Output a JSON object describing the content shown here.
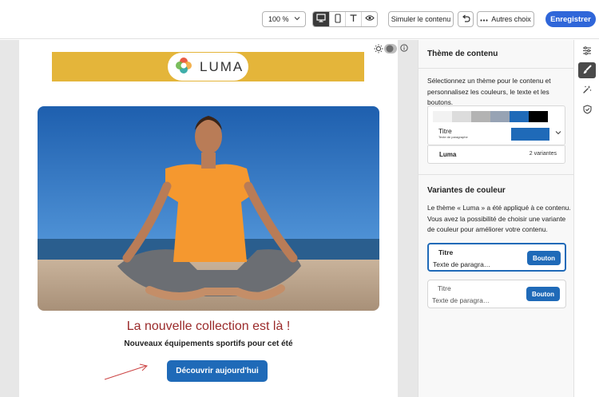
{
  "toolbar": {
    "zoom_label": "100 %",
    "simulate_label": "Simuler le contenu",
    "more_label": "Autres choix",
    "save_label": "Enregistrer"
  },
  "email": {
    "brand": "LUMA",
    "headline": "La nouvelle collection est là !",
    "subline": "Nouveaux équipements sportifs pour cet été",
    "cta": "Découvrir aujourd'hui"
  },
  "panel": {
    "title": "Thème de contenu",
    "description": "Sélectionnez un thème pour le contenu et personnalisez les couleurs, le texte et les boutons.",
    "theme_card": {
      "swatches": [
        "#f2f2f2",
        "#dcdcdc",
        "#b3b3b3",
        "#97a3b4",
        "#1f6ab8",
        "#000000"
      ],
      "preview_title": "Titre",
      "preview_small": "Texte de paragraphe",
      "name": "Luma",
      "variants": "2 variantes"
    },
    "variants_title": "Variantes de couleur",
    "variants_desc": "Le thème « Luma » a été appliqué à ce contenu. Vous avez la possibilité de choisir une variante de couleur pour améliorer votre contenu.",
    "variant_list": [
      {
        "title": "Titre",
        "text": "Texte de paragra…",
        "button": "Bouton",
        "selected": true
      },
      {
        "title": "Titre",
        "text": "Texte de paragra…",
        "button": "Bouton",
        "selected": false
      }
    ]
  },
  "colors": {
    "accent": "#2f66d9",
    "brand_yellow": "#e4b53a",
    "headline_red": "#9a2a2a",
    "button_blue": "#1f6ab8"
  },
  "icons": [
    "chevron-down-icon",
    "desktop-icon",
    "mobile-icon",
    "text-icon",
    "eye-icon",
    "undo-icon",
    "more-icon",
    "sun-icon",
    "toggle-icon",
    "info-icon",
    "settings-sliders-icon",
    "brush-icon",
    "magic-icon",
    "shield-icon",
    "luma-logo-icon",
    "arrow-annotation-icon"
  ]
}
